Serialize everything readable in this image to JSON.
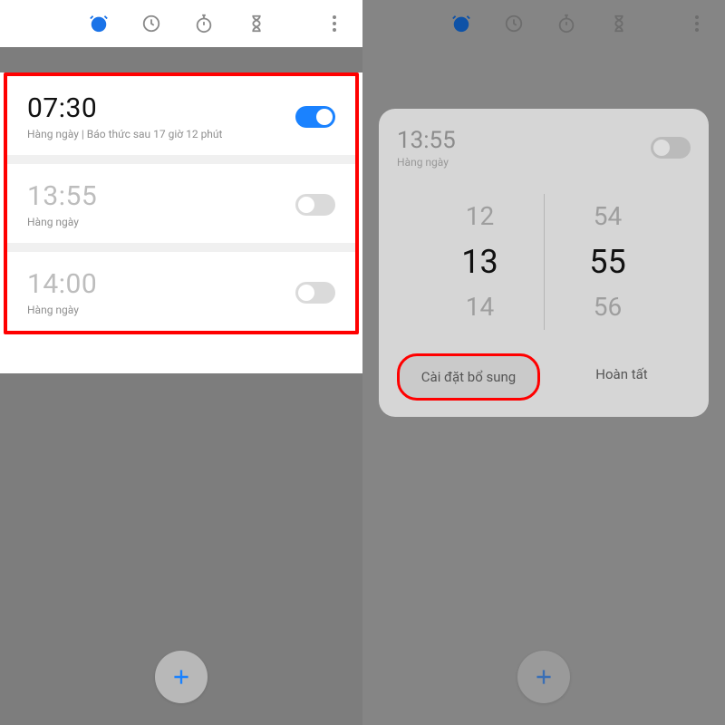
{
  "left": {
    "alarms": [
      {
        "time": "07:30",
        "sub": "Hàng ngày | Báo thức sau 17 giờ 12 phút",
        "on": true
      },
      {
        "time": "13:55",
        "sub": "Hàng ngày",
        "on": false
      },
      {
        "time": "14:00",
        "sub": "Hàng ngày",
        "on": false
      }
    ]
  },
  "right": {
    "header": {
      "time": "13:55",
      "sub": "Hàng ngày",
      "on": false
    },
    "wheel": {
      "hour_prev": "12",
      "hour_sel": "13",
      "hour_next": "14",
      "min_prev": "54",
      "min_sel": "55",
      "min_next": "56"
    },
    "buttons": {
      "more": "Cài đặt bổ sung",
      "done": "Hoàn tất"
    }
  },
  "colors": {
    "accent": "#1a82ff",
    "highlight": "#ff0000"
  }
}
